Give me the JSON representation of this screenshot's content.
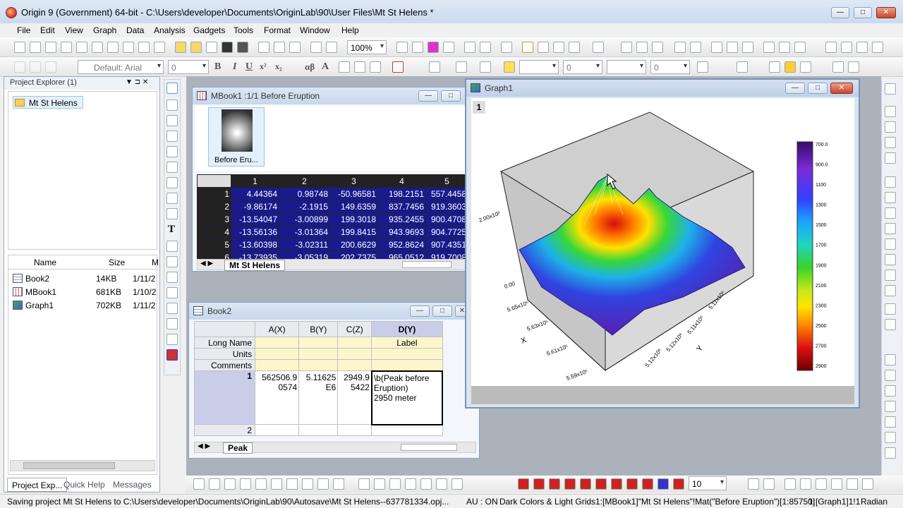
{
  "app": {
    "title": "Origin 9 (Government) 64-bit - C:\\Users\\developer\\Documents\\OriginLab\\90\\User Files\\Mt St Helens *"
  },
  "menu": [
    "File",
    "Edit",
    "View",
    "Graph",
    "Data",
    "Analysis",
    "Gadgets",
    "Tools",
    "Format",
    "Window",
    "Help"
  ],
  "toolbar": {
    "zoom": "100%",
    "font": "Default: Arial",
    "fontsize": "0",
    "linewidth": "0",
    "fillwidth": "0",
    "bold": "B",
    "italic": "I",
    "underline": "U",
    "sup": "x²",
    "sub": "x₂",
    "greek": "αβ",
    "capA": "A"
  },
  "explorer": {
    "title": "Project Explorer (1)",
    "folder": "Mt St Helens",
    "columns": [
      "Name",
      "Size",
      "M"
    ],
    "items": [
      {
        "name": "Book2",
        "size": "14KB",
        "date": "1/11/2"
      },
      {
        "name": "MBook1",
        "size": "681KB",
        "date": "1/10/2"
      },
      {
        "name": "Graph1",
        "size": "702KB",
        "date": "1/11/2"
      }
    ],
    "tabs": [
      "Project Exp...",
      "Quick Help",
      "Messages ..."
    ]
  },
  "mbook": {
    "title": "MBook1 :1/1 Before Eruption",
    "thumb_label": "Before Eru...",
    "cols": [
      "1",
      "2",
      "3",
      "4",
      "5"
    ],
    "rows": [
      [
        "1",
        "4.44364",
        "0.98748",
        "-50.96581",
        "198.2151",
        "557.4458"
      ],
      [
        "2",
        "-9.86174",
        "-2.1915",
        "149.6359",
        "837.7456",
        "919.3603"
      ],
      [
        "3",
        "-13.54047",
        "-3.00899",
        "199.3018",
        "935.2455",
        "900.4708"
      ],
      [
        "4",
        "-13.56136",
        "-3.01364",
        "199.8415",
        "943.9693",
        "904.7725"
      ],
      [
        "5",
        "-13.60398",
        "-3.02311",
        "200.6629",
        "952.8624",
        "907.4351"
      ],
      [
        "6",
        "-13.73935",
        "-3.05319",
        "202.7375",
        "965.0512",
        "919.7008"
      ]
    ],
    "tab": "Mt St Helens"
  },
  "book2": {
    "title": "Book2",
    "cols": [
      "A(X)",
      "B(Y)",
      "C(Z)",
      "D(Y)"
    ],
    "rowlabels": [
      "Long Name",
      "Units",
      "Comments"
    ],
    "longname_d": "Label",
    "row1": {
      "num": "1",
      "a": "562506.9\n0574",
      "b": "5.11625\nE6",
      "c": "2949.9\n5422",
      "d": "\\b(Peak before\nEruption)\n 2950 meter"
    },
    "row2": "2",
    "tab": "Peak"
  },
  "graph": {
    "title": "Graph1",
    "layer": "1",
    "colorbar": [
      "700.0",
      "900.0",
      "1100",
      "1300",
      "1500",
      "1700",
      "1900",
      "2100",
      "2300",
      "2500",
      "2700",
      "2900"
    ],
    "zlabels": [
      "2.00x10³",
      "0.00"
    ],
    "xlabels": [
      "5.65x10⁵",
      "5.63x10⁵",
      "5.61x10⁵",
      "5.59x10⁵"
    ],
    "ylabels": [
      "5.11x10⁶",
      "5.11x10⁶",
      "5.12x10⁶",
      "5.12x10⁶"
    ],
    "xaxis": "X",
    "yaxis": "Y"
  },
  "bottomtb": {
    "value": "10"
  },
  "status": {
    "left": "Saving project Mt St Helens to C:\\Users\\developer\\Documents\\OriginLab\\90\\Autosave\\Mt St Helens--637781334.opj...",
    "au": "AU : ON",
    "theme": "Dark Colors & Light Grids",
    "ref": "1:[MBook1]\"Mt St Helens\"!Mat(\"Before Eruption\")[1:85750]",
    "graphref": "1:[Graph1]1!1",
    "unit": "Radian"
  }
}
